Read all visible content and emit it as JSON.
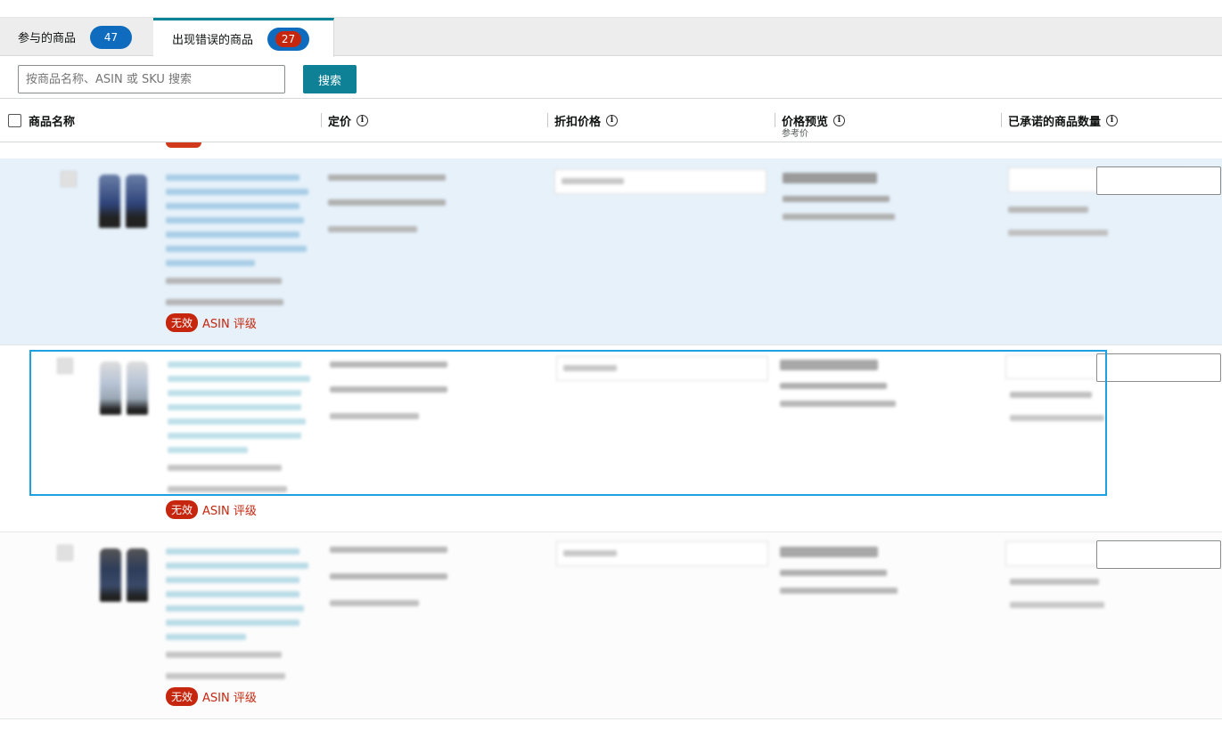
{
  "tabs": [
    {
      "label": "参与的商品",
      "count": "47"
    },
    {
      "label": "出现错误的商品",
      "count": "27"
    }
  ],
  "search": {
    "placeholder": "按商品名称、ASIN 或 SKU 搜索",
    "button": "搜索"
  },
  "table": {
    "headers": {
      "name": "商品名称",
      "list_price": "定价",
      "discount_price": "折扣价格",
      "price_preview": "价格预览",
      "price_preview_sub": "参考价",
      "committed_qty": "已承诺的商品数量"
    },
    "info_icon": "info-icon"
  },
  "rows": [
    {
      "status_badge": "无效",
      "status_text": "ASIN 评级"
    },
    {
      "status_badge": "无效",
      "status_text": "ASIN 评级"
    },
    {
      "status_badge": "无效",
      "status_text": "ASIN 评级"
    }
  ],
  "colors": {
    "accent": "#008296",
    "badge_blue": "#0f6bbd",
    "error_red": "#c7260e",
    "highlight": "#1fa0e0",
    "selected_row": "#e6f1fa"
  }
}
